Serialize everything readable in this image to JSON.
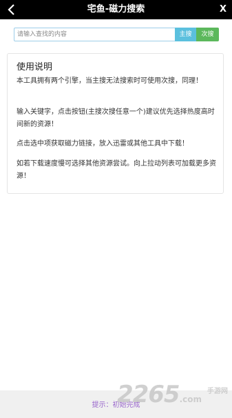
{
  "header": {
    "back_icon": "chevron-left-icon",
    "title": "宅鱼-磁力搜索",
    "close_label": "X"
  },
  "search": {
    "placeholder": "请输入查找的内容",
    "value": "",
    "main_button": "主搜",
    "second_button": "次搜"
  },
  "instructions": {
    "heading": "使用说明",
    "paragraphs": [
      "本工具拥有两个引擎，当主搜无法搜索时可使用次搜，同理！",
      "输入关键字，点击按钮(主搜次搜任意一个)建议优先选择热度高时间新的资源！",
      "点击选中项获取磁力链接，放入迅雷或其他工具中下载！",
      "如若下载速度慢可选择其他资源尝试。向上拉动列表可加载更多资源！"
    ]
  },
  "footer": {
    "tip": "提示：初始完成"
  },
  "watermark": {
    "number": "2265",
    "domain": ".com",
    "site": "手游网"
  },
  "colors": {
    "titlebar": "#000000",
    "main_button": "#5bc0de",
    "second_button": "#5cb85c",
    "tip_text": "#9966cc"
  }
}
